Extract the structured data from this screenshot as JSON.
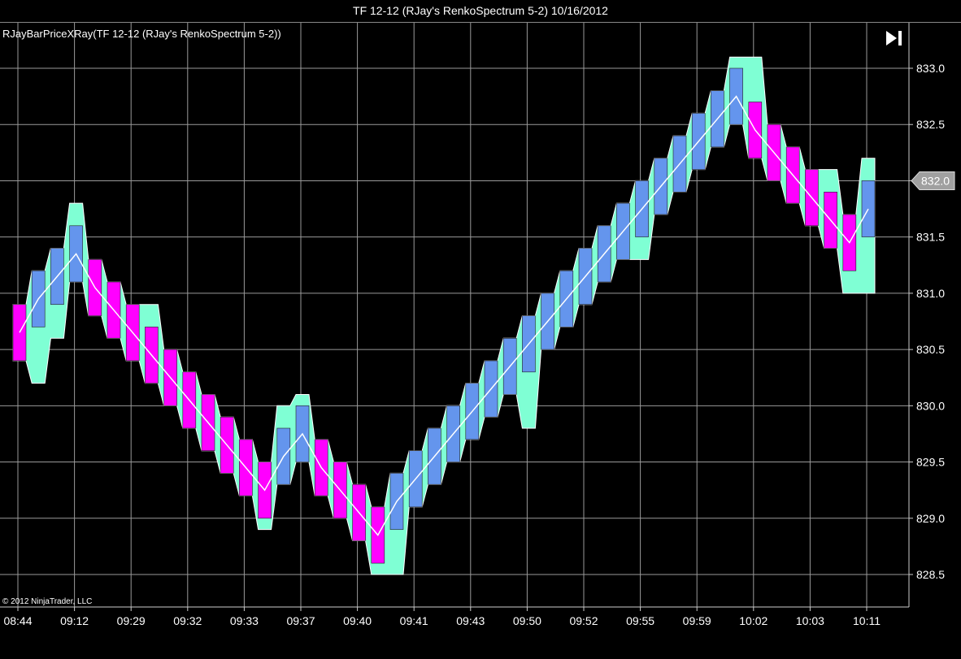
{
  "window": {
    "title": "TF 12-12 (RJay's RenkoSpectrum 5-2)  10/16/2012"
  },
  "indicator_label": "RJayBarPriceXRay(TF 12-12 (RJay's RenkoSpectrum 5-2))",
  "copyright": "© 2012 NinjaTrader, LLC",
  "colors": {
    "background": "#000000",
    "grid": "#9a9a9a",
    "up_bar": "#6495ed",
    "down_bar": "#ff00ff",
    "band": "#7fffd4",
    "close_line": "#ffffff",
    "price_marker": "#a0a0a0"
  },
  "icons": {
    "play_end": "skip-to-end-icon"
  },
  "chart_data": {
    "type": "bar",
    "subtype": "renko",
    "title": "TF 12-12 (RJay's RenkoSpectrum 5-2)  10/16/2012",
    "date": "10/16/2012",
    "ylim": [
      828.3,
      833.3
    ],
    "y_ticks": [
      833.0,
      832.5,
      832.0,
      831.5,
      831.0,
      830.5,
      830.0,
      829.5,
      829.0,
      828.5
    ],
    "x_tick_labels": [
      "08:44",
      "09:12",
      "09:29",
      "09:32",
      "09:33",
      "09:37",
      "09:40",
      "09:41",
      "09:43",
      "09:50",
      "09:52",
      "09:55",
      "09:59",
      "10:02",
      "10:03",
      "10:11"
    ],
    "last_price": "832.0",
    "grid": true,
    "bars": [
      {
        "dir": "down",
        "open": 830.9,
        "close": 830.4,
        "high": 830.9,
        "low": 830.4
      },
      {
        "dir": "up",
        "open": 830.7,
        "close": 831.2,
        "high": 831.2,
        "low": 830.2
      },
      {
        "dir": "up",
        "open": 830.9,
        "close": 831.4,
        "high": 831.4,
        "low": 830.6
      },
      {
        "dir": "up",
        "open": 831.1,
        "close": 831.6,
        "high": 831.8,
        "low": 831.1
      },
      {
        "dir": "down",
        "open": 831.3,
        "close": 830.8,
        "high": 831.3,
        "low": 830.8
      },
      {
        "dir": "down",
        "open": 831.1,
        "close": 830.6,
        "high": 831.1,
        "low": 830.6
      },
      {
        "dir": "down",
        "open": 830.9,
        "close": 830.4,
        "high": 830.9,
        "low": 830.4
      },
      {
        "dir": "down",
        "open": 830.7,
        "close": 830.2,
        "high": 830.9,
        "low": 830.2
      },
      {
        "dir": "down",
        "open": 830.5,
        "close": 830.0,
        "high": 830.5,
        "low": 830.0
      },
      {
        "dir": "down",
        "open": 830.3,
        "close": 829.8,
        "high": 830.3,
        "low": 829.8
      },
      {
        "dir": "down",
        "open": 830.1,
        "close": 829.6,
        "high": 830.1,
        "low": 829.6
      },
      {
        "dir": "down",
        "open": 829.9,
        "close": 829.4,
        "high": 829.9,
        "low": 829.4
      },
      {
        "dir": "down",
        "open": 829.7,
        "close": 829.2,
        "high": 829.7,
        "low": 829.2
      },
      {
        "dir": "down",
        "open": 829.5,
        "close": 829.0,
        "high": 829.5,
        "low": 828.9
      },
      {
        "dir": "up",
        "open": 829.3,
        "close": 829.8,
        "high": 830.0,
        "low": 829.3
      },
      {
        "dir": "up",
        "open": 829.5,
        "close": 830.0,
        "high": 830.1,
        "low": 829.5
      },
      {
        "dir": "down",
        "open": 829.7,
        "close": 829.2,
        "high": 829.7,
        "low": 829.2
      },
      {
        "dir": "down",
        "open": 829.5,
        "close": 829.0,
        "high": 829.5,
        "low": 829.0
      },
      {
        "dir": "down",
        "open": 829.3,
        "close": 828.8,
        "high": 829.3,
        "low": 828.8
      },
      {
        "dir": "down",
        "open": 829.1,
        "close": 828.6,
        "high": 829.1,
        "low": 828.5
      },
      {
        "dir": "up",
        "open": 828.9,
        "close": 829.4,
        "high": 829.4,
        "low": 828.5
      },
      {
        "dir": "up",
        "open": 829.1,
        "close": 829.6,
        "high": 829.6,
        "low": 829.1
      },
      {
        "dir": "up",
        "open": 829.3,
        "close": 829.8,
        "high": 829.8,
        "low": 829.3
      },
      {
        "dir": "up",
        "open": 829.5,
        "close": 830.0,
        "high": 830.0,
        "low": 829.5
      },
      {
        "dir": "up",
        "open": 829.7,
        "close": 830.2,
        "high": 830.2,
        "low": 829.7
      },
      {
        "dir": "up",
        "open": 829.9,
        "close": 830.4,
        "high": 830.4,
        "low": 829.9
      },
      {
        "dir": "up",
        "open": 830.1,
        "close": 830.6,
        "high": 830.6,
        "low": 830.1
      },
      {
        "dir": "up",
        "open": 830.3,
        "close": 830.8,
        "high": 830.8,
        "low": 829.8
      },
      {
        "dir": "up",
        "open": 830.5,
        "close": 831.0,
        "high": 831.0,
        "low": 830.5
      },
      {
        "dir": "up",
        "open": 830.7,
        "close": 831.2,
        "high": 831.2,
        "low": 830.7
      },
      {
        "dir": "up",
        "open": 830.9,
        "close": 831.4,
        "high": 831.4,
        "low": 830.9
      },
      {
        "dir": "up",
        "open": 831.1,
        "close": 831.6,
        "high": 831.6,
        "low": 831.1
      },
      {
        "dir": "up",
        "open": 831.3,
        "close": 831.8,
        "high": 831.8,
        "low": 831.3
      },
      {
        "dir": "up",
        "open": 831.5,
        "close": 832.0,
        "high": 832.0,
        "low": 831.3
      },
      {
        "dir": "up",
        "open": 831.7,
        "close": 832.2,
        "high": 832.2,
        "low": 831.7
      },
      {
        "dir": "up",
        "open": 831.9,
        "close": 832.4,
        "high": 832.4,
        "low": 831.9
      },
      {
        "dir": "up",
        "open": 832.1,
        "close": 832.6,
        "high": 832.6,
        "low": 832.1
      },
      {
        "dir": "up",
        "open": 832.3,
        "close": 832.8,
        "high": 832.8,
        "low": 832.3
      },
      {
        "dir": "up",
        "open": 832.5,
        "close": 833.0,
        "high": 833.1,
        "low": 832.5
      },
      {
        "dir": "down",
        "open": 832.7,
        "close": 832.2,
        "high": 833.1,
        "low": 832.2
      },
      {
        "dir": "down",
        "open": 832.5,
        "close": 832.0,
        "high": 832.5,
        "low": 832.0
      },
      {
        "dir": "down",
        "open": 832.3,
        "close": 831.8,
        "high": 832.3,
        "low": 831.8
      },
      {
        "dir": "down",
        "open": 832.1,
        "close": 831.6,
        "high": 832.1,
        "low": 831.6
      },
      {
        "dir": "down",
        "open": 831.9,
        "close": 831.4,
        "high": 832.1,
        "low": 831.4
      },
      {
        "dir": "down",
        "open": 831.7,
        "close": 831.2,
        "high": 831.7,
        "low": 831.0
      },
      {
        "dir": "up",
        "open": 831.5,
        "close": 832.0,
        "high": 832.2,
        "low": 831.0
      }
    ]
  }
}
